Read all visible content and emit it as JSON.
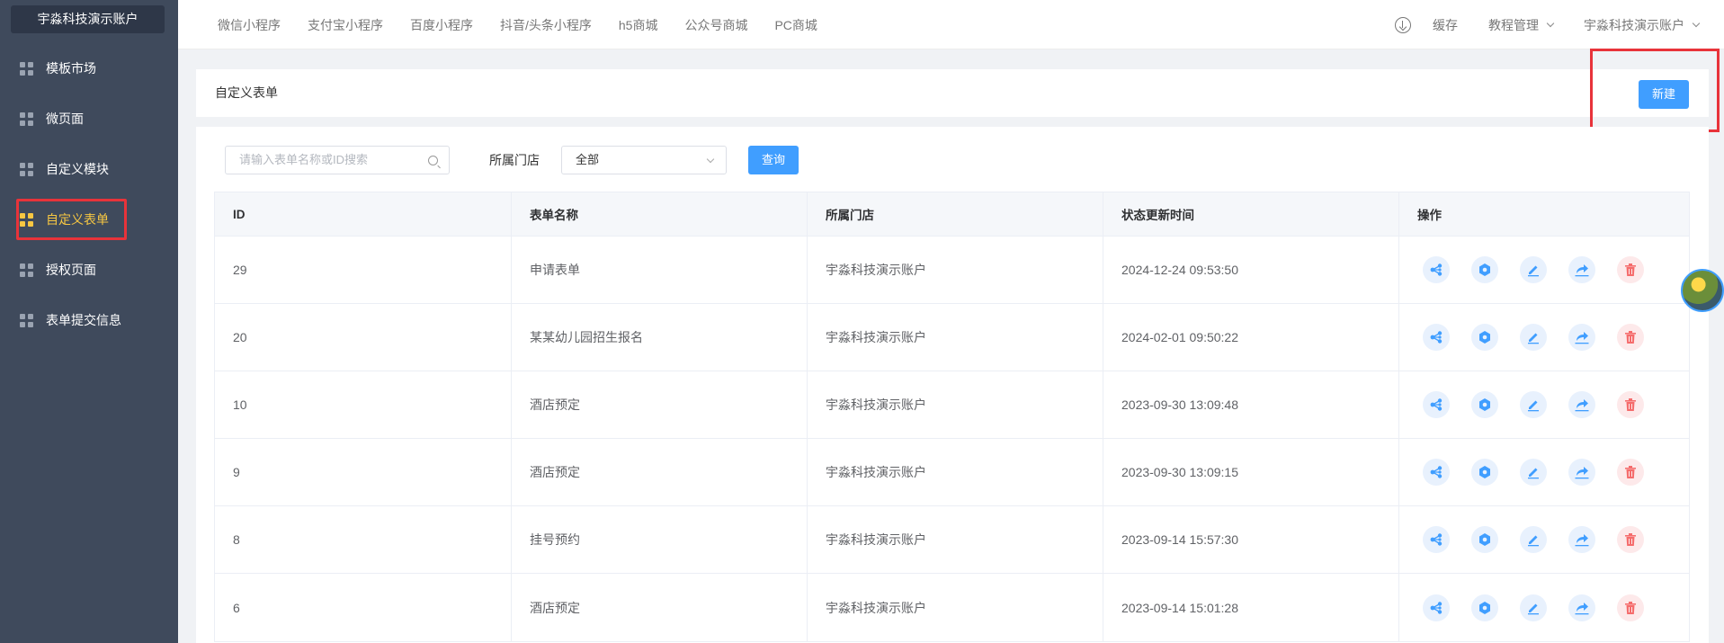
{
  "sidebar": {
    "brand": "宇淼科技演示账户",
    "items": [
      {
        "label": "模板市场"
      },
      {
        "label": "微页面"
      },
      {
        "label": "自定义模块"
      },
      {
        "label": "自定义表单"
      },
      {
        "label": "授权页面"
      },
      {
        "label": "表单提交信息"
      }
    ],
    "active_index": 3
  },
  "topnav": {
    "items": [
      "微信小程序",
      "支付宝小程序",
      "百度小程序",
      "抖音/头条小程序",
      "h5商城",
      "公众号商城",
      "PC商城"
    ]
  },
  "topright": {
    "cache": "缓存",
    "tutorial": "教程管理",
    "account": "宇淼科技演示账户"
  },
  "header": {
    "title": "自定义表单",
    "new_label": "新建"
  },
  "filters": {
    "search_placeholder": "请输入表单名称或ID搜索",
    "store_label": "所属门店",
    "store_value": "全部",
    "query_label": "查询"
  },
  "table": {
    "columns": [
      "ID",
      "表单名称",
      "所属门店",
      "状态更新时间",
      "操作"
    ],
    "rows": [
      {
        "id": "29",
        "name": "申请表单",
        "store": "宇淼科技演示账户",
        "time": "2024-12-24 09:53:50"
      },
      {
        "id": "20",
        "name": "某某幼儿园招生报名",
        "store": "宇淼科技演示账户",
        "time": "2024-02-01 09:50:22"
      },
      {
        "id": "10",
        "name": "酒店预定",
        "store": "宇淼科技演示账户",
        "time": "2023-09-30 13:09:48"
      },
      {
        "id": "9",
        "name": "酒店预定",
        "store": "宇淼科技演示账户",
        "time": "2023-09-30 13:09:15"
      },
      {
        "id": "8",
        "name": "挂号预约",
        "store": "宇淼科技演示账户",
        "time": "2023-09-14 15:57:30"
      },
      {
        "id": "6",
        "name": "酒店预定",
        "store": "宇淼科技演示账户",
        "time": "2023-09-14 15:01:28"
      }
    ],
    "row_actions": [
      "share-icon",
      "settings-icon",
      "edit-icon",
      "forward-icon",
      "delete-icon"
    ]
  },
  "colors": {
    "sidebar_bg": "#3f4a5c",
    "active": "#f7c742",
    "primary": "#409eff",
    "highlight": "#e8333a"
  }
}
